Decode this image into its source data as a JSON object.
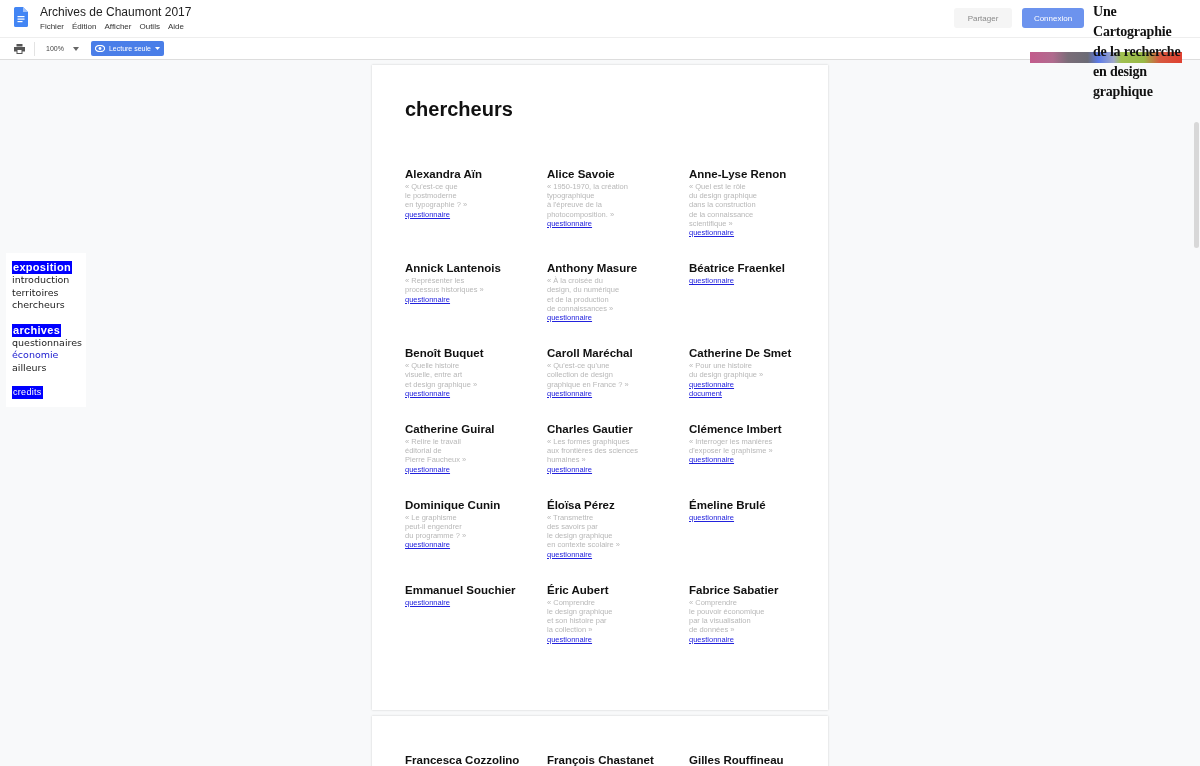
{
  "document": {
    "title": "Archives de Chaumont 2017",
    "menu": [
      "Fichier",
      "Édition",
      "Afficher",
      "Outils",
      "Aide"
    ]
  },
  "toolbar": {
    "zoom": "100%",
    "mode_button": "Lecture seule"
  },
  "header_buttons": [
    {
      "label": "Partager",
      "disabled": true
    },
    {
      "label": "Connexion",
      "disabled": false
    }
  ],
  "logo": {
    "lines": [
      "Une",
      "Cartographie",
      "de la recherche",
      "en design",
      "graphique"
    ]
  },
  "nav": [
    {
      "text": "exposition",
      "kind": "heading"
    },
    {
      "text": "introduction",
      "kind": "link",
      "selected": false
    },
    {
      "text": "territoires",
      "kind": "link",
      "selected": false
    },
    {
      "text": "chercheurs",
      "kind": "link",
      "selected": false
    },
    {
      "text": "archives",
      "kind": "heading"
    },
    {
      "text": "questionnaires",
      "kind": "link",
      "selected": false
    },
    {
      "text": "économie",
      "kind": "link",
      "selected": true
    },
    {
      "text": "ailleurs",
      "kind": "link",
      "selected": false
    },
    {
      "text": "credits",
      "kind": "heading"
    }
  ],
  "page": {
    "heading": "chercheurs",
    "researchers": [
      {
        "name": "Alexandra Aïn",
        "quote": [
          "« Qu'est-ce que",
          "le postmoderne",
          "en typographie ? »"
        ],
        "links": [
          "questionnaire"
        ]
      },
      {
        "name": "Alice Savoie",
        "quote": [
          "« 1950-1970, la création",
          "typographique",
          "à l'épreuve de la",
          "photocomposition. »"
        ],
        "links": [
          "questionnaire"
        ]
      },
      {
        "name": "Anne-Lyse Renon",
        "quote": [
          "« Quel est le rôle",
          "du design graphique",
          "dans la construction",
          "de la connaissance",
          "scientifique »"
        ],
        "links": [
          "questionnaire"
        ]
      },
      {
        "name": "Annick Lantenois",
        "quote": [
          "« Représenter les",
          "processus historiques »"
        ],
        "links": [
          "questionnaire"
        ]
      },
      {
        "name": "Anthony Masure",
        "quote": [
          "« À la croisée du",
          "design, du numérique",
          "et de la production",
          "de connaissances  »"
        ],
        "links": [
          "questionnaire"
        ]
      },
      {
        "name": "Béatrice Fraenkel",
        "links": [
          "questionnaire"
        ]
      },
      {
        "name": "Benoît Buquet",
        "quote": [
          "« Quelle histoire",
          "visuelle, entre art",
          "et design graphique  »"
        ],
        "links": [
          "questionnaire"
        ]
      },
      {
        "name": "Caroll Maréchal",
        "quote": [
          "« Qu'est-ce qu'une",
          "collection de design",
          "graphique en France ? »"
        ],
        "links": [
          "questionnaire"
        ]
      },
      {
        "name": "Catherine De Smet",
        "quote": [
          "« Pour une histoire",
          "du design graphique »"
        ],
        "links": [
          "questionnaire",
          "document"
        ]
      },
      {
        "name": "Catherine Guiral",
        "quote": [
          "« Relire le travail",
          "éditorial de",
          "Pierre Faucheux »"
        ],
        "links": [
          "questionnaire"
        ]
      },
      {
        "name": "Charles Gautier",
        "quote": [
          "« Les formes graphiques",
          "aux frontières des sciences",
          "humaines »"
        ],
        "links": [
          "questionnaire"
        ]
      },
      {
        "name": "Clémence Imbert",
        "quote": [
          "« Interroger les manières",
          "d'exposer le graphisme  »"
        ],
        "links": [
          "questionnaire"
        ]
      },
      {
        "name": "Dominique Cunin",
        "quote": [
          "« Le graphisme",
          "peut-il engendrer",
          "du programme ? »"
        ],
        "links": [
          "questionnaire"
        ]
      },
      {
        "name": "Éloïsa Pérez",
        "quote": [
          "« Transmettre",
          "des savoirs par",
          "le design graphique",
          "en contexte scolaire »"
        ],
        "links": [
          "questionnaire"
        ]
      },
      {
        "name": "Émeline Brulé",
        "links": [
          "questionnaire"
        ]
      },
      {
        "name": "Emmanuel Souchier",
        "links": [
          "questionnaire"
        ]
      },
      {
        "name": "Éric Aubert",
        "quote": [
          "« Comprendre",
          "le design graphique",
          "et son histoire par",
          "la collection  »"
        ],
        "links": [
          "questionnaire"
        ]
      },
      {
        "name": "Fabrice Sabatier",
        "quote": [
          "« Comprendre",
          "le pouvoir économique",
          "par la visualisation",
          "de données  »"
        ],
        "links": [
          "questionnaire"
        ]
      }
    ]
  },
  "next_page": {
    "researchers": [
      {
        "name": "Francesca Cozzolino"
      },
      {
        "name": "François Chastanet"
      },
      {
        "name": "Gilles Rouffineau"
      }
    ]
  }
}
